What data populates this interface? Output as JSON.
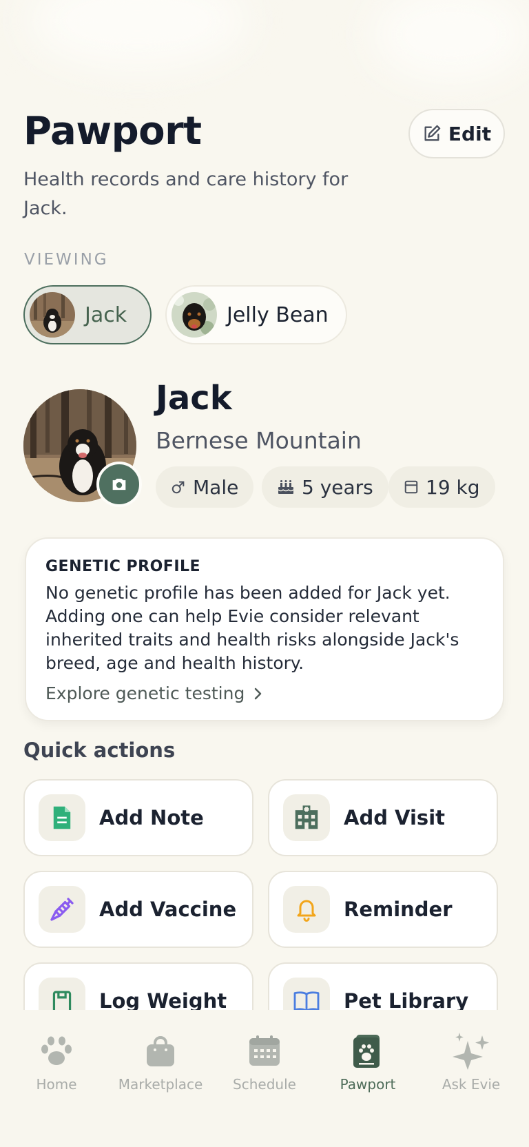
{
  "header": {
    "title": "Pawport",
    "subtitle": "Health records and care history for Jack.",
    "edit_label": "Edit"
  },
  "viewing": {
    "label": "VIEWING",
    "pets": [
      {
        "name": "Jack",
        "selected": true
      },
      {
        "name": "Jelly Bean",
        "selected": false
      }
    ]
  },
  "profile": {
    "name": "Jack",
    "breed": "Bernese Mountain",
    "sex": "Male",
    "age": "5 years",
    "weight": "19 kg"
  },
  "genetic": {
    "title": "GENETIC PROFILE",
    "text": "No genetic profile has been added for Jack yet. Adding one can help Evie consider relevant inherited traits and health risks alongside Jack's breed, age and health history.",
    "link": "Explore genetic testing"
  },
  "quick_actions": {
    "title": "Quick actions",
    "items": [
      {
        "label": "Add Note",
        "icon": "note-icon"
      },
      {
        "label": "Add Visit",
        "icon": "hospital-icon"
      },
      {
        "label": "Add Vaccine",
        "icon": "syringe-icon"
      },
      {
        "label": "Reminder",
        "icon": "bell-icon"
      },
      {
        "label": "Log Weight",
        "icon": "scale-icon"
      },
      {
        "label": "Pet Library",
        "icon": "book-icon"
      }
    ]
  },
  "nav": {
    "items": [
      {
        "label": "Home",
        "icon": "paw-icon"
      },
      {
        "label": "Marketplace",
        "icon": "bag-icon"
      },
      {
        "label": "Schedule",
        "icon": "calendar-icon"
      },
      {
        "label": "Pawport",
        "icon": "pawport-icon",
        "active": true
      },
      {
        "label": "Ask Evie",
        "icon": "sparkle-icon"
      }
    ]
  },
  "colors": {
    "background": "#f9f7ef",
    "accent": "#4f7060",
    "note": "#2fb07a",
    "vaccine": "#8a5cf0",
    "reminder": "#f2a51a",
    "library": "#4a7de0"
  }
}
